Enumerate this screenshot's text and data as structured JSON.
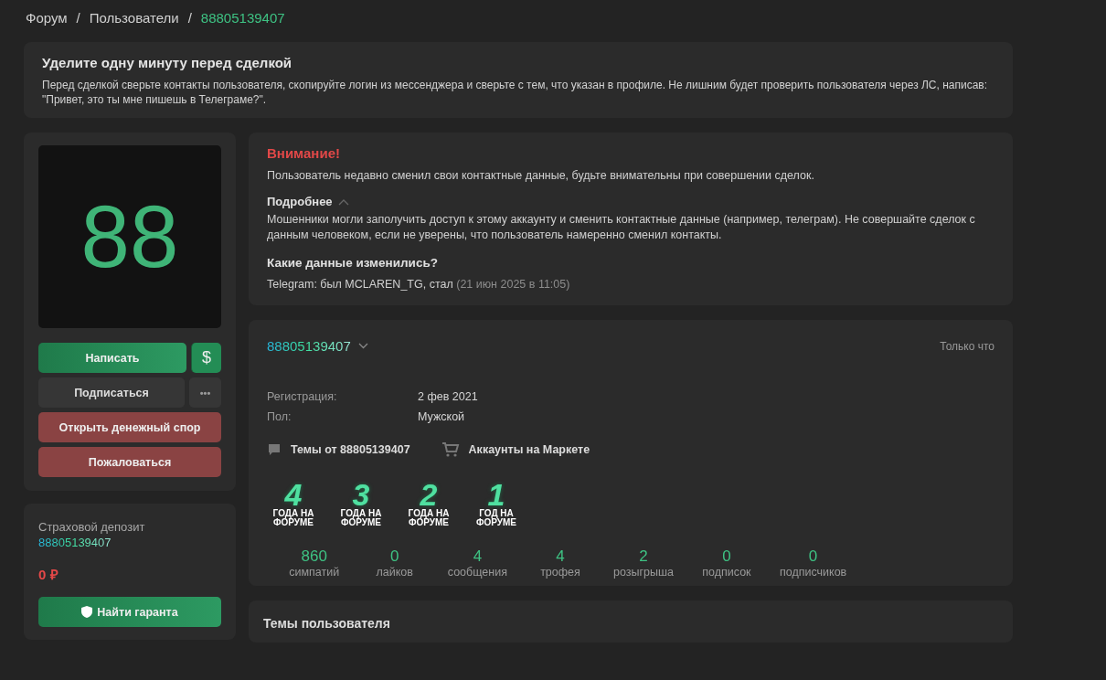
{
  "breadcrumbs": [
    {
      "label": "Форум",
      "current": false
    },
    {
      "label": "Пользователи",
      "current": false
    },
    {
      "label": "88805139407",
      "current": true
    }
  ],
  "breadcrumb_separator": "/",
  "notice": {
    "title": "Уделите одну минуту перед сделкой",
    "text": "Перед сделкой сверьте контакты пользователя, скопируйте логин из мессенджера и сверьте с тем, что указан в профиле. Не лишним будет проверить пользователя через ЛС, написав: \"Привет, это ты мне пишешь в Телеграме?\"."
  },
  "avatar": {
    "text": "88"
  },
  "actions": [
    {
      "label": "Написать",
      "kind": "primary",
      "extra": "$"
    },
    {
      "label": "Подписаться",
      "kind": "secondary",
      "extra": "•••"
    },
    {
      "label": "Открыть денежный спор",
      "kind": "danger"
    },
    {
      "label": "Пожаловаться",
      "kind": "danger"
    }
  ],
  "deposit": {
    "title": "Страховой депозит",
    "username": "88805139407",
    "amount": "0 ₽",
    "button": "Найти гаранта"
  },
  "warning": {
    "title": "Внимание!",
    "text": "Пользователь недавно сменил свои контактные данные, будьте внимательны при совершении сделок.",
    "details_label": "Подробнее",
    "expanded": true,
    "details_text": "Мошенники могли заполучить доступ к этому аккаунту и сменить контактные данные (например, телеграм). Не совершайте сделок с данным человеком, если не уверены, что пользователь намеренно сменил контакты.",
    "changes_title": "Какие данные изменились?",
    "change": "Telegram: был MCLAREN_TG, стал",
    "change_time": "(21 июн 2025 в 11:05)"
  },
  "profile": {
    "username": "88805139407",
    "last_seen": "Только что",
    "fields": [
      {
        "label": "Регистрация:",
        "value": "2 фев 2021"
      },
      {
        "label": "Пол:",
        "value": "Мужской"
      }
    ],
    "links": [
      {
        "kind": "topics",
        "label": "Темы от 88805139407"
      },
      {
        "kind": "market",
        "label": "Аккаунты на Маркете"
      }
    ],
    "badges": [
      {
        "number": "4",
        "caption": "ГОДА НА ФОРУМЕ"
      },
      {
        "number": "3",
        "caption": "ГОДА НА ФОРУМЕ"
      },
      {
        "number": "2",
        "caption": "ГОДА НА ФОРУМЕ"
      },
      {
        "number": "1",
        "caption": "ГОД НА ФОРУМЕ"
      }
    ],
    "stats": [
      {
        "value": "860",
        "label": "симпатий"
      },
      {
        "value": "0",
        "label": "лайков"
      },
      {
        "value": "4",
        "label": "сообщения"
      },
      {
        "value": "4",
        "label": "трофея"
      },
      {
        "value": "2",
        "label": "розыгрыша"
      },
      {
        "value": "0",
        "label": "подписок"
      },
      {
        "value": "0",
        "label": "подписчиков"
      }
    ]
  },
  "topics_card": {
    "title": "Темы пользователя"
  }
}
